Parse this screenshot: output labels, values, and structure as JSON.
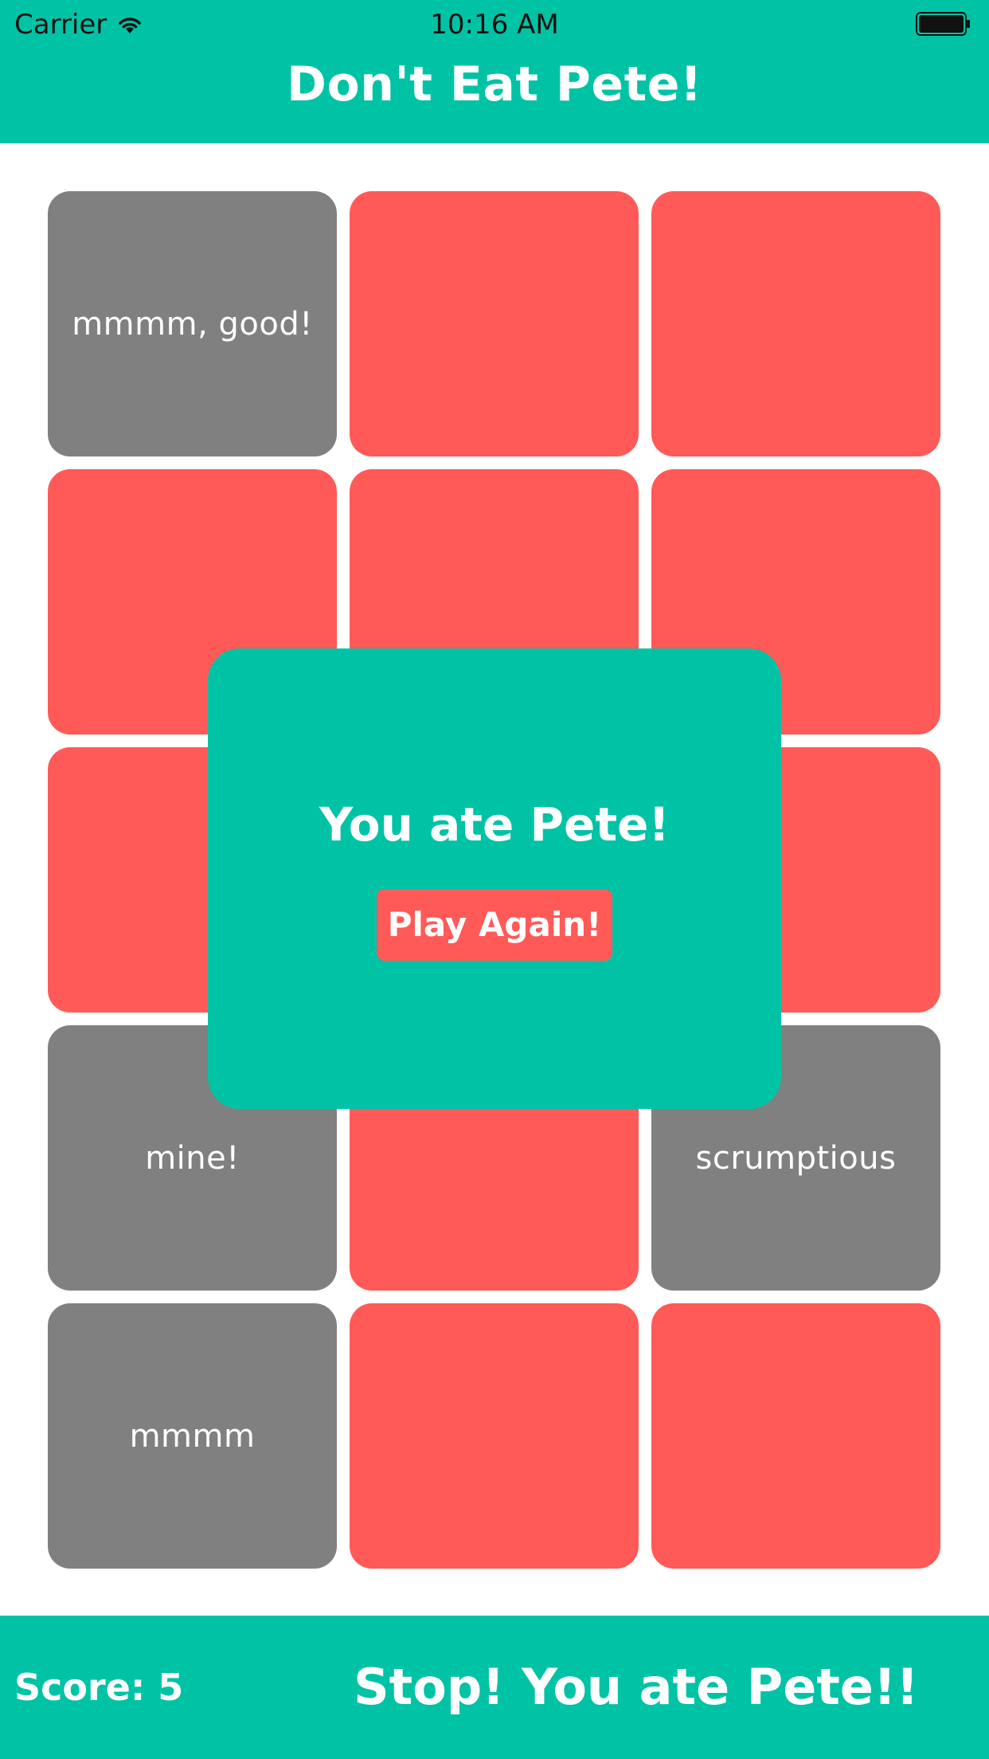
{
  "status_bar": {
    "carrier": "Carrier",
    "time": "10:16 AM",
    "wifi_icon": "wifi-icon",
    "battery_icon": "battery-icon"
  },
  "header": {
    "title": "Don't Eat Pete!"
  },
  "board": {
    "tiles": [
      {
        "state": "revealed",
        "label": "mmmm, good!"
      },
      {
        "state": "hidden",
        "label": ""
      },
      {
        "state": "hidden",
        "label": ""
      },
      {
        "state": "hidden",
        "label": ""
      },
      {
        "state": "hidden",
        "label": ""
      },
      {
        "state": "hidden",
        "label": ""
      },
      {
        "state": "hidden",
        "label": ""
      },
      {
        "state": "hidden",
        "label": ""
      },
      {
        "state": "hidden",
        "label": ""
      },
      {
        "state": "revealed",
        "label": "mine!"
      },
      {
        "state": "hidden",
        "label": ""
      },
      {
        "state": "revealed",
        "label": "scrumptious"
      },
      {
        "state": "revealed",
        "label": "mmmm"
      },
      {
        "state": "hidden",
        "label": ""
      },
      {
        "state": "hidden",
        "label": ""
      }
    ]
  },
  "modal": {
    "title": "You ate Pete!",
    "button_label": "Play Again!"
  },
  "footer": {
    "score_label": "Score:",
    "score_value": "5",
    "message": "Stop! You ate Pete!!"
  },
  "colors": {
    "teal": "#00c3a5",
    "red": "#ff5a57",
    "gray": "#808080",
    "white": "#ffffff"
  }
}
